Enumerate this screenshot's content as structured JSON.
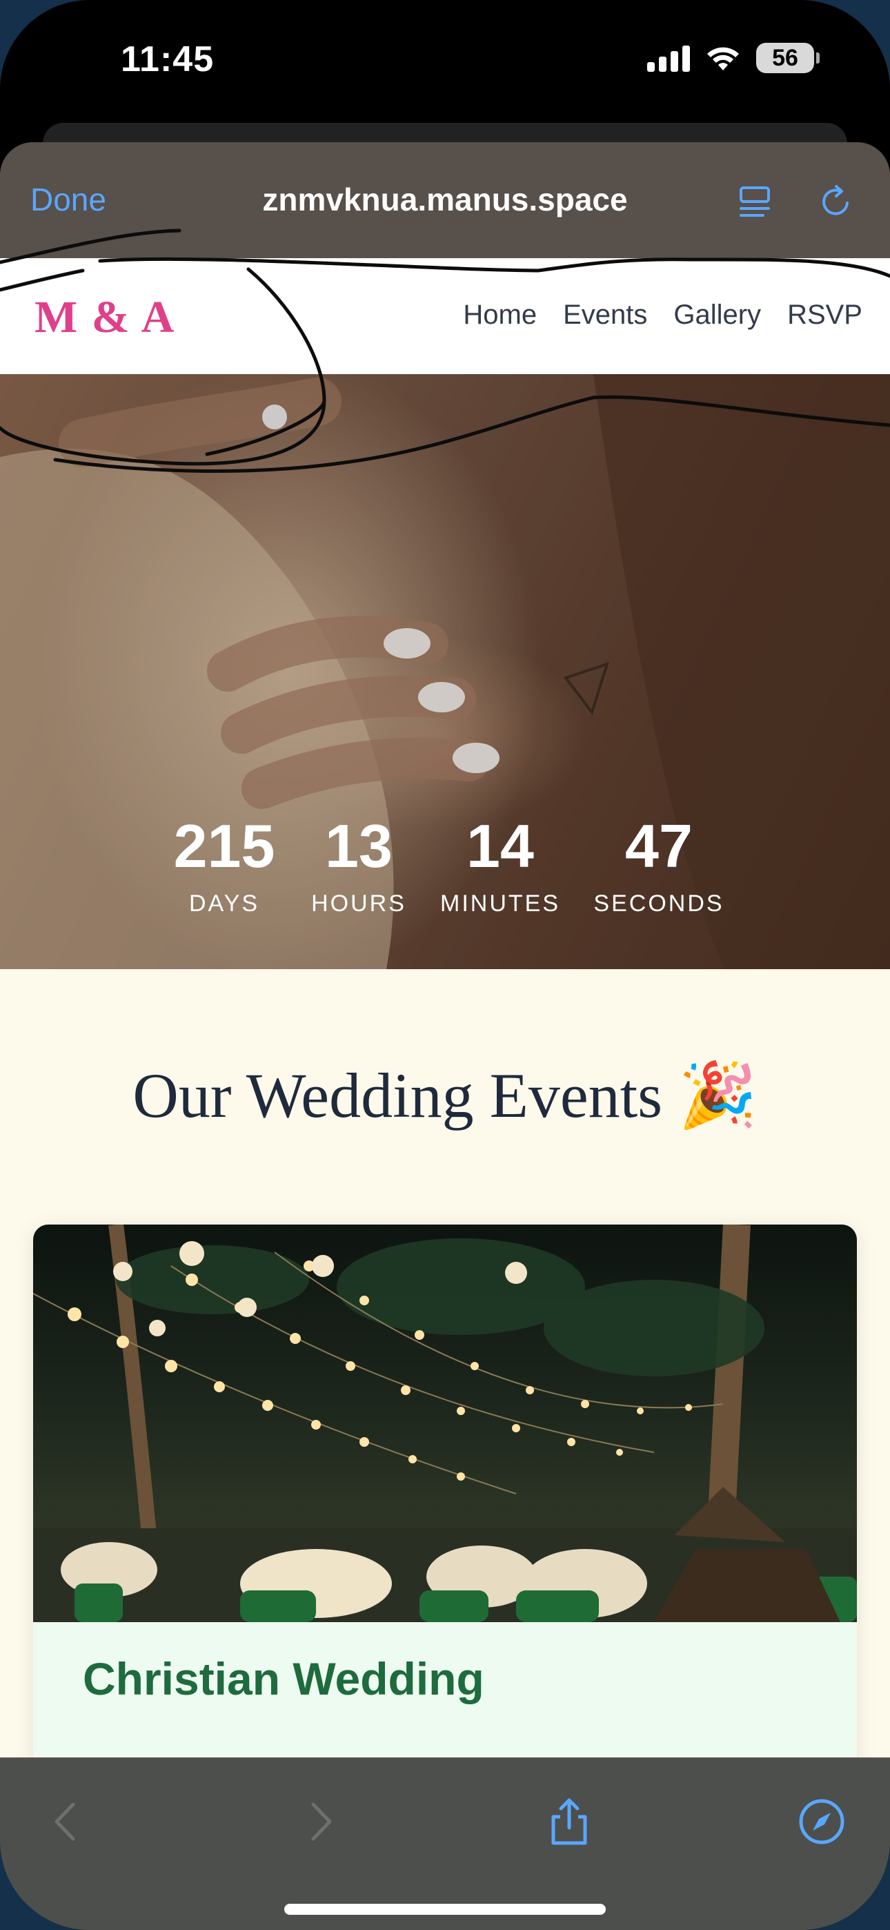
{
  "status_bar": {
    "time": "11:45",
    "battery": "56"
  },
  "browser": {
    "done_label": "Done",
    "url": "znmvknua.manus.space",
    "icons": {
      "reader": "reader-icon",
      "reload": "reload-icon",
      "back": "back-icon",
      "forward": "forward-icon",
      "share": "share-icon",
      "compass": "compass-icon"
    }
  },
  "site": {
    "logo": "M & A",
    "nav": [
      "Home",
      "Events",
      "Gallery",
      "RSVP"
    ],
    "colors": {
      "logo": "#e0408a",
      "event_title": "#1e6b3e",
      "accent_blue": "#5aa6ff"
    }
  },
  "countdown": [
    {
      "value": "215",
      "label": "DAYS"
    },
    {
      "value": "13",
      "label": "HOURS"
    },
    {
      "value": "14",
      "label": "MINUTES"
    },
    {
      "value": "47",
      "label": "SECONDS"
    }
  ],
  "events": {
    "title": "Our Wedding Events 🎉",
    "cards": [
      {
        "name": "Christian Wedding"
      }
    ]
  }
}
